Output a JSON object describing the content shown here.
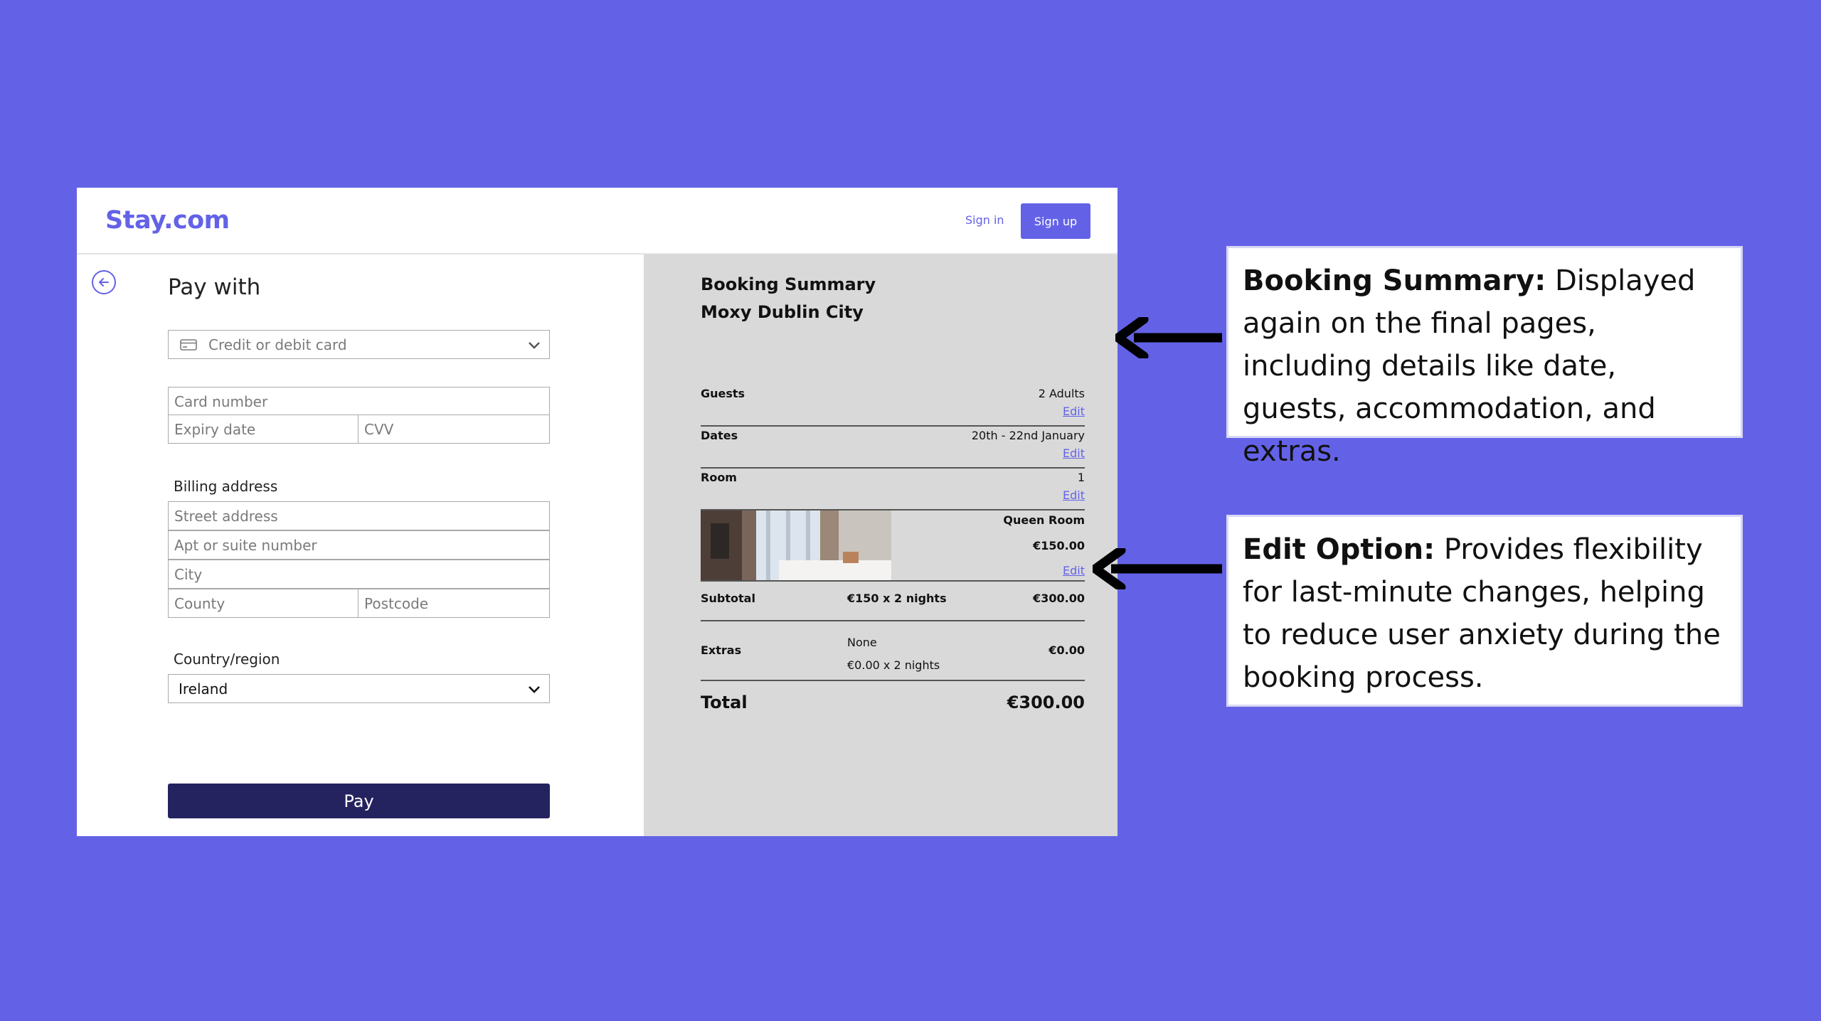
{
  "app": {
    "logo": "Stay.com",
    "sign_in": "Sign in",
    "sign_up": "Sign up"
  },
  "payment": {
    "title": "Pay with",
    "method_select": "Credit or debit card",
    "card_number_placeholder": "Card number",
    "expiry_placeholder": "Expiry date",
    "cvv_placeholder": "CVV",
    "billing_label": "Billing address",
    "street_placeholder": "Street address",
    "apt_placeholder": "Apt or suite number",
    "city_placeholder": "City",
    "county_placeholder": "County",
    "postcode_placeholder": "Postcode",
    "country_label": "Country/region",
    "country_value": "Ireland",
    "pay_button": "Pay"
  },
  "summary": {
    "title": "Booking Summary",
    "hotel": "Moxy Dublin City",
    "guests_label": "Guests",
    "guests_value": "2 Adults",
    "dates_label": "Dates",
    "dates_value": "20th - 22nd January",
    "room_label": "Room",
    "room_value": "1",
    "edit": "Edit",
    "room_type": "Queen Room",
    "room_price": "€150.00",
    "subtotal_label": "Subtotal",
    "subtotal_calc": "€150 x 2 nights",
    "subtotal_value": "€300.00",
    "extras_label": "Extras",
    "extras_name": "None",
    "extras_calc": "€0.00 x 2 nights",
    "extras_value": "€0.00",
    "total_label": "Total",
    "total_value": "€300.00"
  },
  "callouts": {
    "booking_title": "Booking Summary:",
    "booking_text": " Displayed again on the final pages, including details like date, guests, accommodation, and extras.",
    "edit_title": "Edit Option:",
    "edit_text": " Provides flexibility for last-minute changes, helping to reduce user anxiety during the booking process."
  },
  "colors": {
    "background": "#6362e7",
    "brand": "#6362e7",
    "pay_button": "#25235f",
    "summary_panel": "#d9d9d9"
  }
}
